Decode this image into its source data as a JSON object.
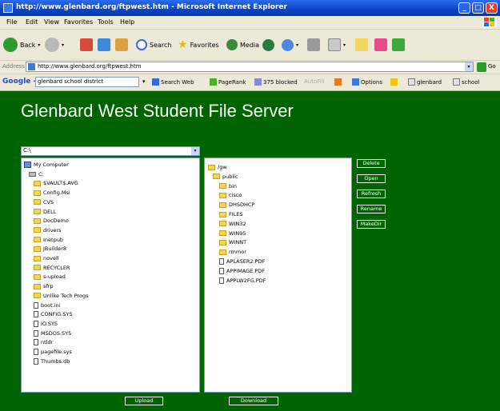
{
  "window": {
    "title": "http://www.glenbard.org/ftpwest.htm - Microsoft Internet Explorer",
    "controls": {
      "minimize": "_",
      "maximize": "□",
      "close": "X"
    }
  },
  "menu": [
    "File",
    "Edit",
    "View",
    "Favorites",
    "Tools",
    "Help"
  ],
  "toolbar": {
    "back": "Back",
    "search": "Search",
    "favorites": "Favorites",
    "media": "Media"
  },
  "address": {
    "label": "Address",
    "url": "http://www.glenbard.org/ftpwest.htm",
    "go": "Go"
  },
  "google_bar": {
    "logo": "Google -",
    "query": "glenbard school district",
    "search_web": "Search Web",
    "pagerank": "PageRank",
    "blocked": "375 blocked",
    "autofill": "AutoFill",
    "options": "Options",
    "highlight1": "glenbard",
    "highlight2": "school"
  },
  "page": {
    "title": "Glenbard West Student File Server",
    "drive_select": "C:\\",
    "drive_arrow": "▾",
    "local_tree": [
      {
        "type": "computer",
        "name": "My Computer"
      },
      {
        "type": "drive",
        "name": "C:"
      },
      {
        "type": "folder",
        "name": "$VAULT$.AVG"
      },
      {
        "type": "folder",
        "name": "Config.Msi"
      },
      {
        "type": "folder",
        "name": "CVS"
      },
      {
        "type": "folder",
        "name": "DELL"
      },
      {
        "type": "folder",
        "name": "DocDemo"
      },
      {
        "type": "folder",
        "name": "drivers"
      },
      {
        "type": "folder",
        "name": "Inetpub"
      },
      {
        "type": "folder",
        "name": "JBuilder8"
      },
      {
        "type": "folder",
        "name": "novell"
      },
      {
        "type": "folder",
        "name": "RECYCLER"
      },
      {
        "type": "folder",
        "name": "s-upload"
      },
      {
        "type": "folder",
        "name": "sfrp"
      },
      {
        "type": "folder",
        "name": "Unlike Tech Progs"
      },
      {
        "type": "file",
        "name": "boot.ini"
      },
      {
        "type": "file",
        "name": "CONFIG.SYS"
      },
      {
        "type": "file",
        "name": "IO.SYS"
      },
      {
        "type": "file",
        "name": "MSDOS.SYS"
      },
      {
        "type": "file",
        "name": "ntldr"
      },
      {
        "type": "file",
        "name": "pagefile.sys"
      },
      {
        "type": "file",
        "name": "Thumbs.db"
      }
    ],
    "remote_tree": [
      {
        "type": "folder",
        "name": "/gw"
      },
      {
        "type": "folder",
        "name": "public"
      },
      {
        "type": "folder",
        "name": "bin"
      },
      {
        "type": "folder",
        "name": "cisco"
      },
      {
        "type": "folder",
        "name": "DHSDHCP"
      },
      {
        "type": "folder",
        "name": "FILES"
      },
      {
        "type": "folder",
        "name": "WIN32"
      },
      {
        "type": "folder",
        "name": "WIN95"
      },
      {
        "type": "folder",
        "name": "WINNT"
      },
      {
        "type": "folder",
        "name": "rmmor"
      },
      {
        "type": "file",
        "name": "APLASER2.PDF"
      },
      {
        "type": "file",
        "name": "APPIMAGE.PDF"
      },
      {
        "type": "file",
        "name": "APPLW2FG.PDF"
      }
    ],
    "side_buttons": [
      "Delete",
      "Open",
      "Refresh",
      "Rename",
      "MakeDir"
    ],
    "upload": "Upload",
    "download": "Download"
  }
}
